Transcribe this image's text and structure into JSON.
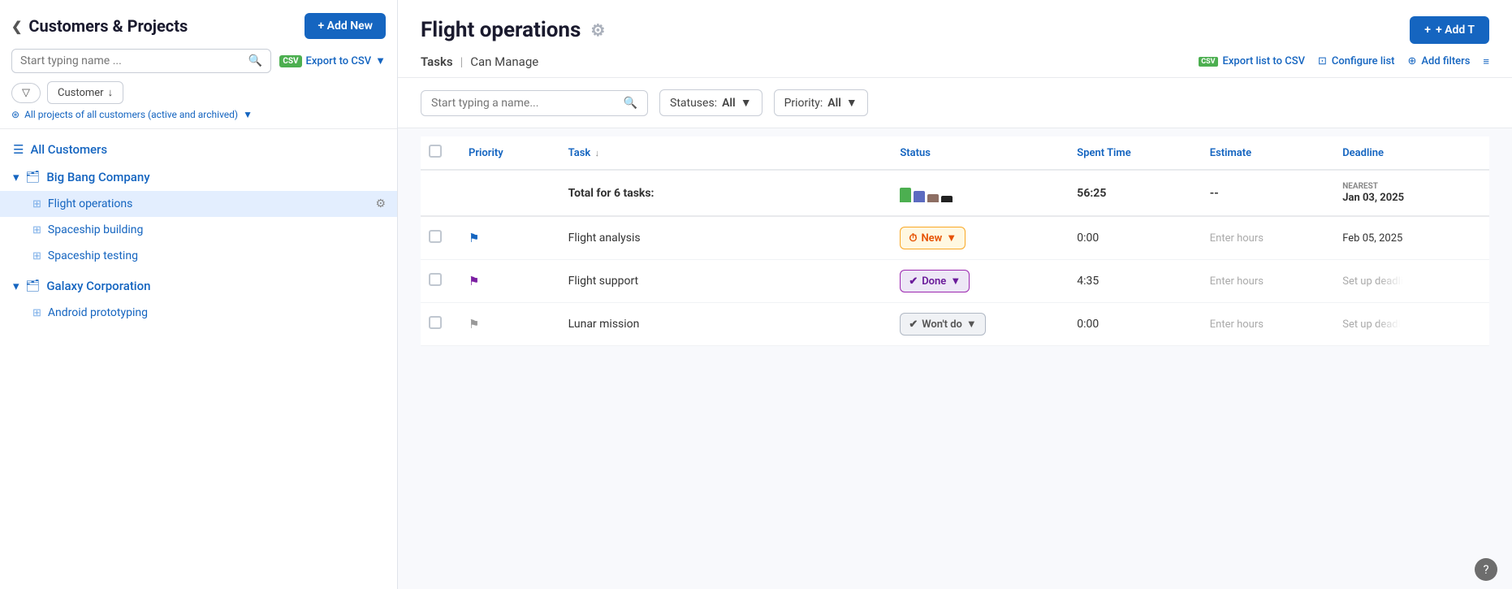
{
  "sidebar": {
    "title": "Customers & Projects",
    "add_new_label": "+ Add New",
    "search_placeholder": "Start typing name ...",
    "export_csv_label": "Export to CSV",
    "dropdown_label": "▼",
    "customer_filter_label": "Customer",
    "all_projects_filter": "All projects of all customers (active and archived)",
    "all_customers_label": "All Customers",
    "customers": [
      {
        "name": "Big Bang Company",
        "expanded": true,
        "projects": [
          {
            "name": "Flight operations",
            "active": true
          },
          {
            "name": "Spaceship building",
            "active": false
          },
          {
            "name": "Spaceship testing",
            "active": false
          }
        ]
      },
      {
        "name": "Galaxy Corporation",
        "expanded": true,
        "projects": [
          {
            "name": "Android prototyping",
            "active": false
          }
        ]
      }
    ]
  },
  "main": {
    "title": "Flight operations",
    "add_task_label": "+ Add T",
    "tasks_label": "Tasks",
    "can_manage_label": "Can Manage",
    "export_list_csv": "Export list to CSV",
    "configure_list": "Configure list",
    "add_filters": "Add filters",
    "search_placeholder": "Start typing a name...",
    "statuses_label": "Statuses:",
    "statuses_value": "All",
    "priority_label": "Priority:",
    "priority_value": "All",
    "table": {
      "headers": [
        "",
        "Priority",
        "Task ↓",
        "Status",
        "Spent Time",
        "Estimate",
        "Deadline"
      ],
      "total_row": {
        "label": "Total for 6 tasks:",
        "spent_time": "56:25",
        "estimate": "--",
        "deadline_nearest": "NEAREST",
        "deadline_value": "Jan 03, 2025",
        "bars": [
          {
            "color": "#4caf50",
            "height": 18
          },
          {
            "color": "#5c6bc0",
            "height": 14
          },
          {
            "color": "#8d6e63",
            "height": 10
          },
          {
            "color": "#212121",
            "height": 8
          }
        ]
      },
      "rows": [
        {
          "flag_color": "blue",
          "task_name": "Flight analysis",
          "status": "New",
          "status_type": "new",
          "spent_time": "0:00",
          "estimate": "Enter hours",
          "deadline": "Feb 05, 2025",
          "deadline_nearest": ""
        },
        {
          "flag_color": "purple",
          "task_name": "Flight support",
          "status": "Done",
          "status_type": "done",
          "spent_time": "4:35",
          "estimate": "Enter hours",
          "deadline": "Set up deadli",
          "deadline_nearest": ""
        },
        {
          "flag_color": "gray",
          "task_name": "Lunar mission",
          "status": "Won't do",
          "status_type": "wontdo",
          "spent_time": "0:00",
          "estimate": "Enter hours",
          "deadline": "Set up deadl",
          "deadline_nearest": ""
        }
      ]
    }
  },
  "icons": {
    "search": "🔍",
    "gear": "⚙",
    "csv": "CSV",
    "chevron_down": "▼",
    "chevron_left": "❮",
    "plus": "+",
    "flag": "⚑",
    "filter": "⊕",
    "configure": "⊡",
    "check_circle": "✔",
    "clock": "⏱",
    "list": "≡",
    "question": "?"
  }
}
